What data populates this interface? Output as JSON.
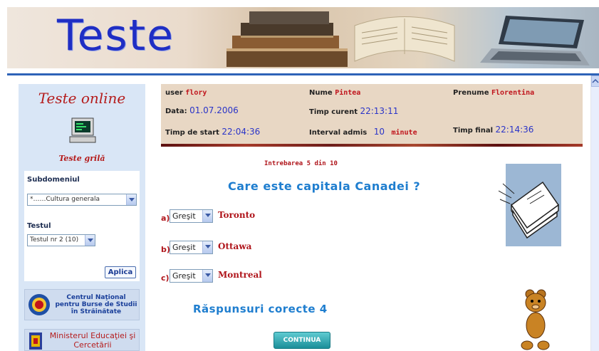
{
  "banner": {
    "title": "Teste"
  },
  "sidebar": {
    "title": "Teste online",
    "subtitle": "Teste grilă",
    "subdomeniu_label": "Subdomeniul",
    "subdomeniu_value": "*……Cultura generala",
    "testul_label": "Testul",
    "testul_value": "Testul nr 2 (10)",
    "aplica_label": "Aplica",
    "logo1_text": "Centrul Naţional pentru Burse de Studii în Străinătate",
    "logo2_text": "Ministerul Educaţiei şi Cercetării"
  },
  "info": {
    "user_label": "user",
    "user_value": "flory",
    "nume_label": "Nume",
    "nume_value": "Pintea",
    "prenume_label": "Prenume",
    "prenume_value": "Florentina",
    "data_label": "Data:",
    "data_value": "01.07.2006",
    "timp_curent_label": "Timp curent",
    "timp_curent_value": "22:13:11",
    "timp_start_label": "Timp de start",
    "timp_start_value": "22:04:36",
    "interval_label": "Interval admis",
    "interval_value": "10",
    "interval_unit": "minute",
    "timp_final_label": "Timp final",
    "timp_final_value": "22:14:36"
  },
  "quiz": {
    "counter": "Intrebarea 5 din 10",
    "question": "Care este capitala Canadei ?",
    "answers": [
      {
        "letter": "a)",
        "choice": "Greşit",
        "text": "Toronto"
      },
      {
        "letter": "b)",
        "choice": "Greşit",
        "text": "Ottawa"
      },
      {
        "letter": "c)",
        "choice": "Greşit",
        "text": "Montreal"
      }
    ],
    "result": "Răspunsuri corecte 4",
    "continue_label": "CONTINUA"
  },
  "icons": [
    "computer-icon",
    "chevron-down-icon",
    "scroll-up-icon"
  ]
}
